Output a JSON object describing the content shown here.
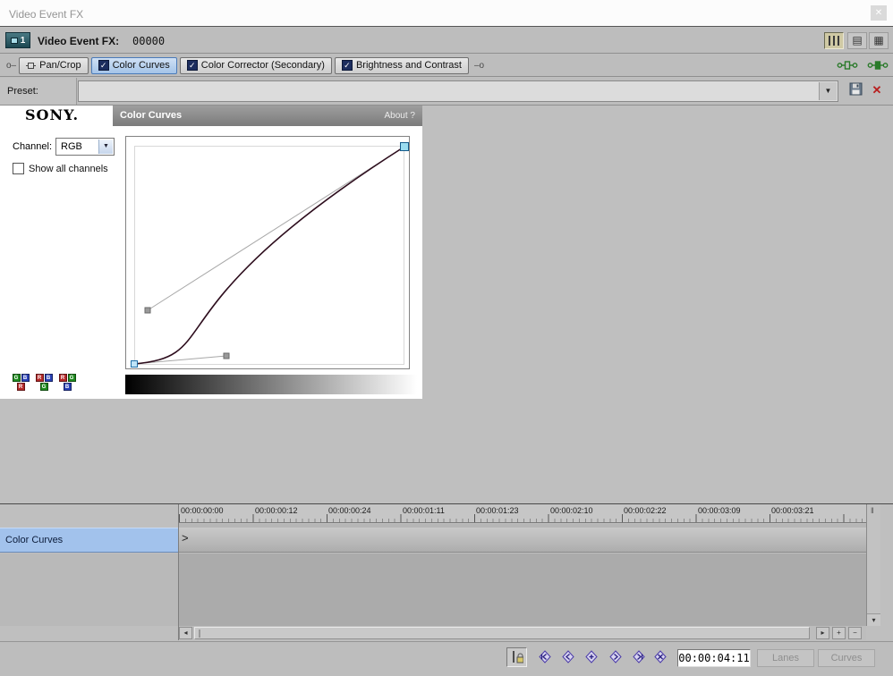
{
  "window": {
    "title": "Video Event FX",
    "close_glyph": "✕"
  },
  "header": {
    "badge": "1",
    "title": "Video Event FX:",
    "event_id": "00000"
  },
  "chain": {
    "start_connector": "o–",
    "end_connector": "–o",
    "pan_crop_label": "Pan/Crop",
    "color_curves_label": "Color Curves",
    "color_corrector_label": "Color Corrector (Secondary)",
    "brightness_label": "Brightness and Contrast"
  },
  "preset": {
    "label": "Preset:",
    "value": ""
  },
  "plugin": {
    "brand": "SONY.",
    "title": "Color Curves",
    "about_label": "About ?",
    "channel_label": "Channel:",
    "channel_value": "RGB",
    "show_all_label": "Show all channels",
    "show_all_checked": false,
    "group1": [
      "G",
      "B",
      "R"
    ],
    "group2": [
      "R",
      "B",
      "G"
    ],
    "group3": [
      "R",
      "G",
      "B"
    ],
    "channel_colors": {
      "R": "#b52929",
      "G": "#1f8a1f",
      "B": "#2940b5"
    },
    "curve": {
      "channel": "RGB",
      "start_point": [
        0.0,
        0.0
      ],
      "end_point": [
        1.0,
        1.0
      ],
      "start_handle": [
        0.34,
        0.04
      ],
      "end_handle": [
        0.05,
        0.25
      ],
      "curve_color": "#2d0d1d"
    }
  },
  "timeline": {
    "ticks": [
      "00:00:00:00",
      "00:00:00:12",
      "00:00:00:24",
      "00:00:01:11",
      "00:00:01:23",
      "00:00:02:10",
      "00:00:02:22",
      "00:00:03:09",
      "00:00:03:21"
    ],
    "row_label": "Color Curves",
    "row_marker": ">"
  },
  "scrollbar": {
    "left": "◂",
    "right": "▸",
    "down": "▾",
    "zoom_in": "+",
    "zoom_out": "−",
    "grip": "‖"
  },
  "transport": {
    "timecode": "00:00:04:11",
    "lanes_label": "Lanes",
    "curves_label": "Curves"
  },
  "ui": {
    "combo_arrow": "▼",
    "check": "✓"
  }
}
